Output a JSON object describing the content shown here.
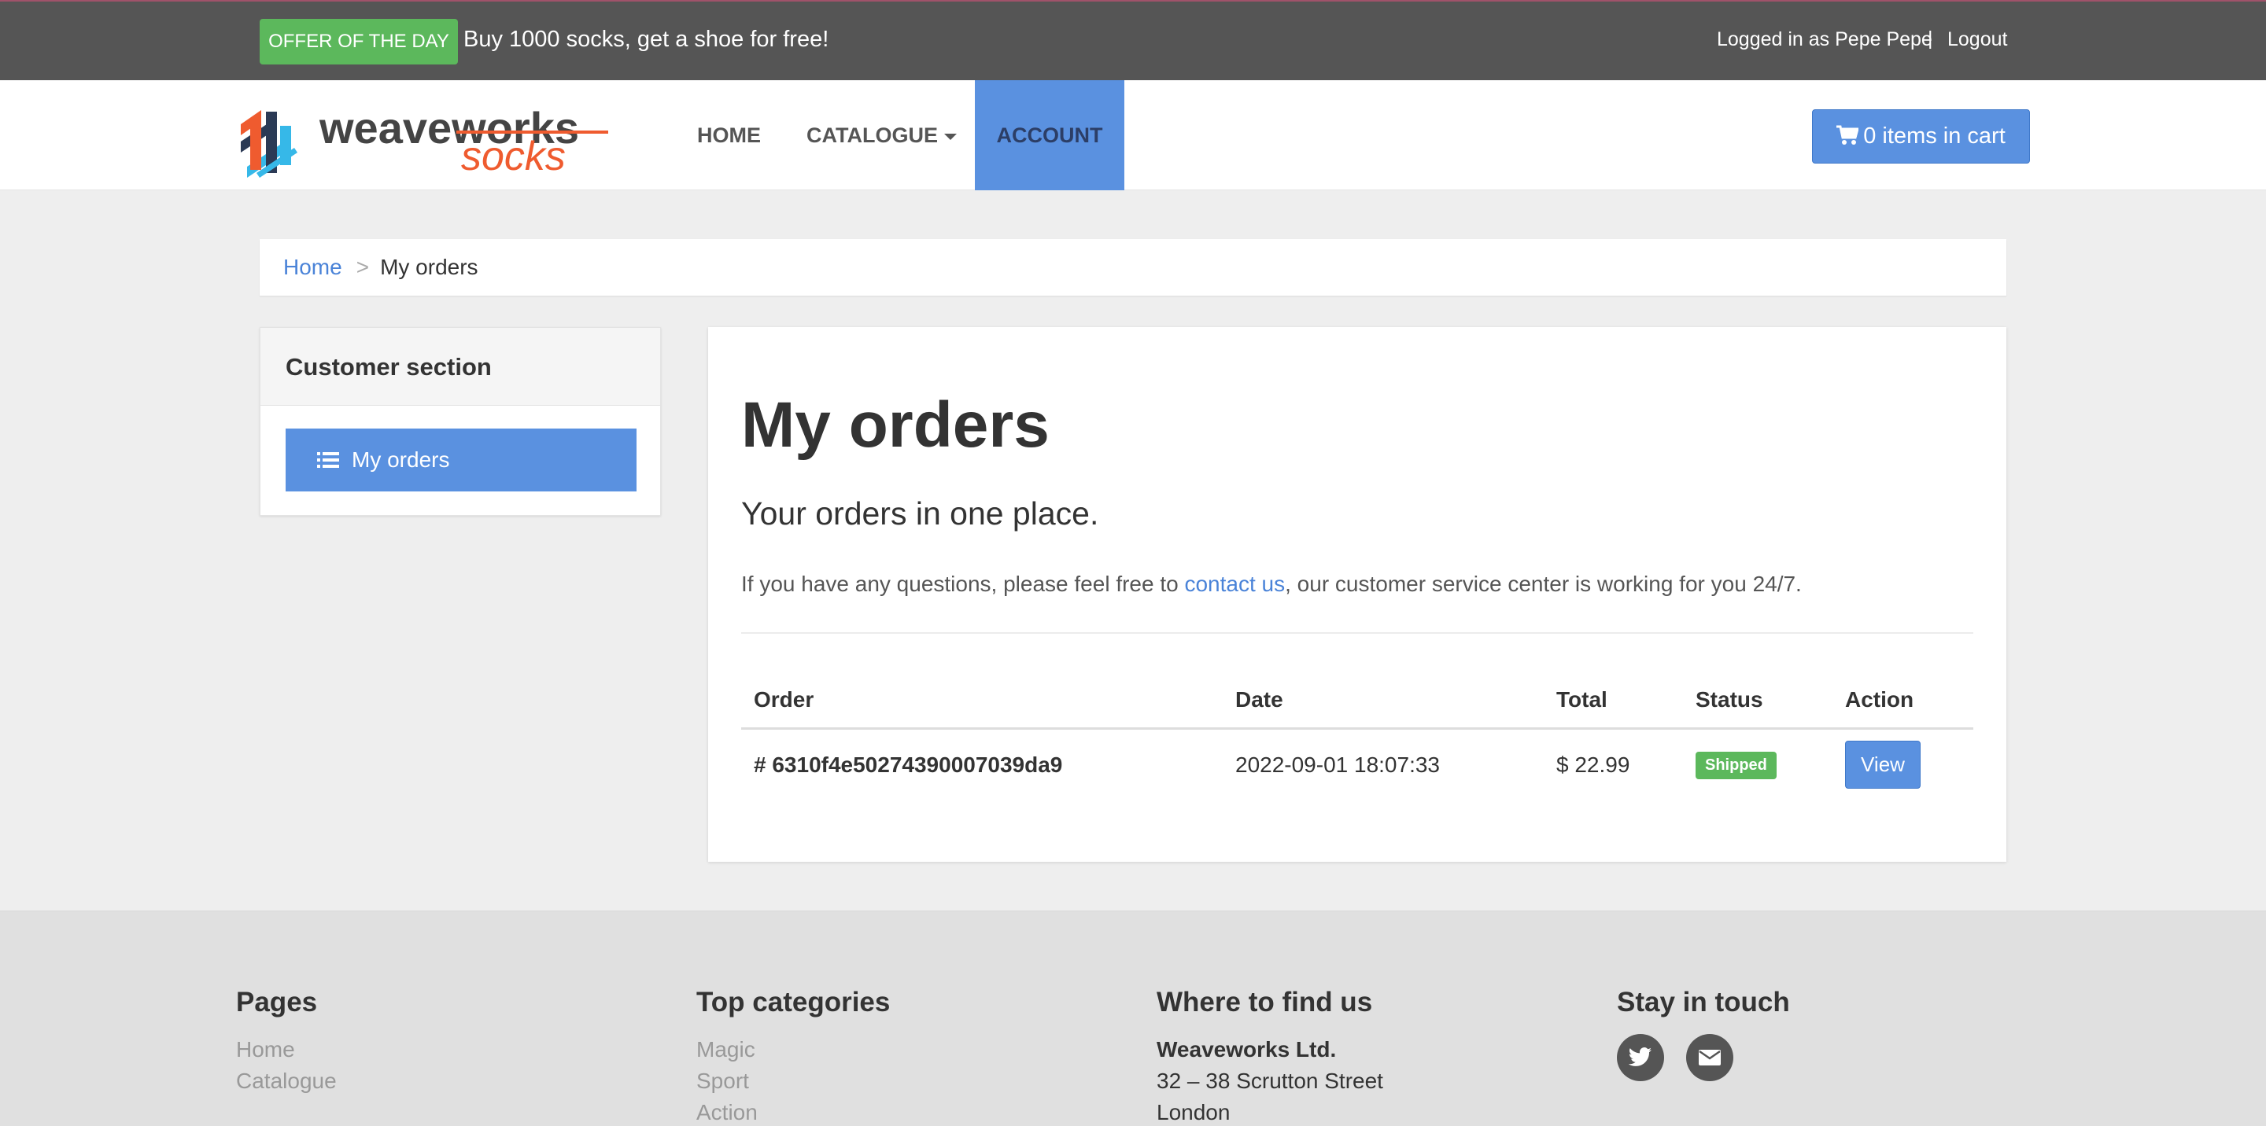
{
  "topbar": {
    "offer_badge": "OFFER OF THE DAY",
    "offer_text": "Buy 1000 socks, get a shoe for free!",
    "login_text": "Logged in as Pepe Pepe",
    "separator": "|",
    "logout_label": "Logout"
  },
  "navbar": {
    "logo_text_top": "weaveworks",
    "logo_text_bottom": "socks",
    "home_label": "HOME",
    "catalogue_label": "CATALOGUE",
    "account_label": "ACCOUNT",
    "cart_label": "0 items in cart"
  },
  "breadcrumb": {
    "home_label": "Home",
    "separator": ">",
    "current_label": "My orders"
  },
  "sidebar": {
    "heading": "Customer section",
    "my_orders_label": "My orders"
  },
  "main": {
    "title": "My orders",
    "lead": "Your orders in one place.",
    "help_before": "If you have any questions, please feel free to ",
    "help_link": "contact us",
    "help_after": ", our customer service center is working for you 24/7.",
    "table": {
      "headers": [
        "Order",
        "Date",
        "Total",
        "Status",
        "Action"
      ],
      "rows": [
        {
          "order": "# 6310f4e50274390007039da9",
          "date": "2022-09-01 18:07:33",
          "total": "$ 22.99",
          "status": "Shipped",
          "action": "View"
        }
      ]
    }
  },
  "footer": {
    "pages": {
      "heading": "Pages",
      "links": [
        "Home",
        "Catalogue"
      ]
    },
    "categories": {
      "heading": "Top categories",
      "links": [
        "Magic",
        "Sport",
        "Action"
      ]
    },
    "where": {
      "heading": "Where to find us",
      "company": "Weaveworks Ltd.",
      "street": "32 – 38 Scrutton Street",
      "city": "London"
    },
    "touch": {
      "heading": "Stay in touch",
      "icons": [
        "twitter-icon",
        "email-icon"
      ]
    }
  },
  "colors": {
    "topbar_bg": "#555555",
    "offer_green": "#5cb85c",
    "accent_blue": "#5a91e0",
    "link_blue": "#4a83d8",
    "page_bg": "#eeeeee",
    "footer_bg": "#e0e0e0"
  }
}
